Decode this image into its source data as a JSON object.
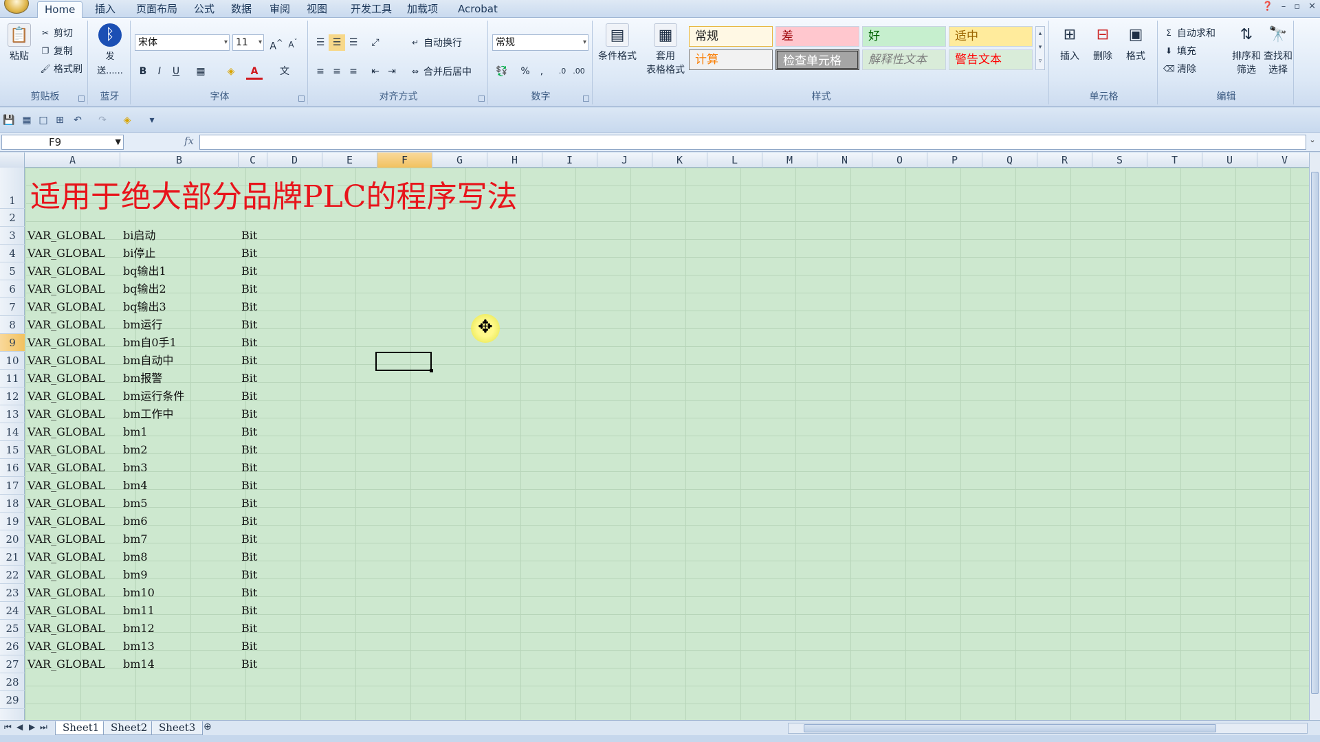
{
  "tabs": [
    "Home",
    "插入",
    "页面布局",
    "公式",
    "数据",
    "审阅",
    "视图",
    "开发工具",
    "加载项",
    "Acrobat"
  ],
  "active_tab": "Home",
  "clipboard": {
    "paste": "粘贴",
    "cut": "剪切",
    "copy": "复制",
    "painter": "格式刷",
    "label": "剪贴板"
  },
  "bluetooth": {
    "send": "发送......",
    "label": "蓝牙"
  },
  "font": {
    "name": "宋体",
    "size": "11",
    "bold": "B",
    "italic": "I",
    "underline": "U",
    "label": "字体"
  },
  "alignment": {
    "wrap": "自动换行",
    "merge": "合并后居中",
    "label": "对齐方式"
  },
  "number": {
    "format": "常规",
    "label": "数字"
  },
  "styles": {
    "cond_format": "条件格式",
    "table_format_1": "套用",
    "table_format_2": "表格格式",
    "items": [
      "常规",
      "差",
      "好",
      "适中",
      "计算",
      "检查单元格",
      "解释性文本",
      "警告文本"
    ],
    "label": "样式"
  },
  "cells_group": {
    "insert": "插入",
    "delete": "删除",
    "format": "格式",
    "label": "单元格"
  },
  "editing": {
    "autosum": "自动求和",
    "fill": "填充",
    "clear": "清除",
    "sort_1": "排序和",
    "sort_2": "筛选",
    "find_1": "查找和",
    "find_2": "选择",
    "label": "编辑"
  },
  "formula_bar": {
    "name_box": "F9",
    "fx": "fx",
    "formula": ""
  },
  "columns": [
    "A",
    "B",
    "C",
    "D",
    "E",
    "F",
    "G",
    "H",
    "I",
    "J",
    "K",
    "L",
    "M",
    "N",
    "O",
    "P",
    "Q",
    "R",
    "S",
    "T",
    "U",
    "V"
  ],
  "selected_column": "F",
  "selected_row": 9,
  "row_numbers": [
    1,
    2,
    3,
    4,
    5,
    6,
    7,
    8,
    9,
    10,
    11,
    12,
    13,
    14,
    15,
    16,
    17,
    18,
    19,
    20,
    21,
    22,
    23,
    24,
    25,
    26,
    27,
    28,
    29
  ],
  "title": "适用于绝大部分品牌PLC的程序写法",
  "rows": [
    {
      "a": "VAR_GLOBAL",
      "b": "bi启动",
      "c": "Bit"
    },
    {
      "a": "VAR_GLOBAL",
      "b": "bi停止",
      "c": "Bit"
    },
    {
      "a": "VAR_GLOBAL",
      "b": "bq输出1",
      "c": "Bit"
    },
    {
      "a": "VAR_GLOBAL",
      "b": "bq输出2",
      "c": "Bit"
    },
    {
      "a": "VAR_GLOBAL",
      "b": "bq输出3",
      "c": "Bit"
    },
    {
      "a": "VAR_GLOBAL",
      "b": "bm运行",
      "c": "Bit"
    },
    {
      "a": "VAR_GLOBAL",
      "b": "bm自0手1",
      "c": "Bit"
    },
    {
      "a": "VAR_GLOBAL",
      "b": "bm自动中",
      "c": "Bit"
    },
    {
      "a": "VAR_GLOBAL",
      "b": "bm报警",
      "c": "Bit"
    },
    {
      "a": "VAR_GLOBAL",
      "b": "bm运行条件",
      "c": "Bit"
    },
    {
      "a": "VAR_GLOBAL",
      "b": "bm工作中",
      "c": "Bit"
    },
    {
      "a": "VAR_GLOBAL",
      "b": "bm1",
      "c": "Bit"
    },
    {
      "a": "VAR_GLOBAL",
      "b": "bm2",
      "c": "Bit"
    },
    {
      "a": "VAR_GLOBAL",
      "b": "bm3",
      "c": "Bit"
    },
    {
      "a": "VAR_GLOBAL",
      "b": "bm4",
      "c": "Bit"
    },
    {
      "a": "VAR_GLOBAL",
      "b": "bm5",
      "c": "Bit"
    },
    {
      "a": "VAR_GLOBAL",
      "b": "bm6",
      "c": "Bit"
    },
    {
      "a": "VAR_GLOBAL",
      "b": "bm7",
      "c": "Bit"
    },
    {
      "a": "VAR_GLOBAL",
      "b": "bm8",
      "c": "Bit"
    },
    {
      "a": "VAR_GLOBAL",
      "b": "bm9",
      "c": "Bit"
    },
    {
      "a": "VAR_GLOBAL",
      "b": "bm10",
      "c": "Bit"
    },
    {
      "a": "VAR_GLOBAL",
      "b": "bm11",
      "c": "Bit"
    },
    {
      "a": "VAR_GLOBAL",
      "b": "bm12",
      "c": "Bit"
    },
    {
      "a": "VAR_GLOBAL",
      "b": "bm13",
      "c": "Bit"
    },
    {
      "a": "VAR_GLOBAL",
      "b": "bm14",
      "c": "Bit"
    }
  ],
  "sheets": [
    "Sheet1",
    "Sheet2",
    "Sheet3"
  ],
  "active_sheet": "Sheet1",
  "colors": {
    "title": "#e8141b",
    "grid_bg": "#cde8cf",
    "selection_header": "#f1c15f"
  }
}
